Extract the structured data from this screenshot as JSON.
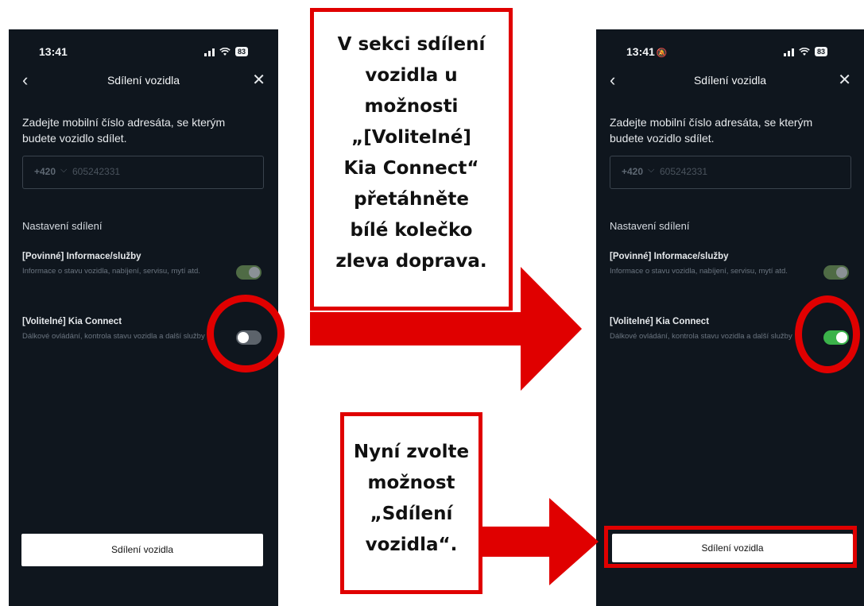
{
  "left_phone": {
    "status": {
      "time": "13:41",
      "battery": "83"
    },
    "nav": {
      "back": "‹",
      "title": "Sdílení vozidla",
      "close": "✕"
    },
    "instruction": "Zadejte mobilní číslo adresáta, se kterým budete vozidlo sdílet.",
    "phone_input": {
      "country_code": "+420",
      "chevron": "⌵",
      "number": "605242331"
    },
    "section_title": "Nastavení sdílení",
    "options": [
      {
        "title": "[Povinné] Informace/služby",
        "desc": "Informace o stavu vozidla, nabíjení, servisu, mytí atd.",
        "state": "on (disabled)"
      },
      {
        "title": "[Volitelné] Kia Connect",
        "desc": "Dálkové ovládání, kontrola stavu vozidla a další služby",
        "state": "off"
      }
    ],
    "share_button": "Sdílení vozidla"
  },
  "right_phone": {
    "status": {
      "time": "13:41",
      "mute_icon": "🔕",
      "battery": "83"
    },
    "nav": {
      "back": "‹",
      "title": "Sdílení vozidla",
      "close": "✕"
    },
    "instruction": "Zadejte mobilní číslo adresáta, se kterým budete vozidlo sdílet.",
    "phone_input": {
      "country_code": "+420",
      "chevron": "⌵",
      "number": "605242331"
    },
    "section_title": "Nastavení sdílení",
    "options": [
      {
        "title": "[Povinné] Informace/služby",
        "desc": "Informace o stavu vozidla, nabíjení, servisu, mytí atd.",
        "state": "on (disabled)"
      },
      {
        "title": "[Volitelné] Kia Connect",
        "desc": "Dálkové ovládání, kontrola stavu vozidla a další služby",
        "state": "on"
      }
    ],
    "share_button": "Sdílení vozidla"
  },
  "callouts": {
    "top": [
      "V sekci sdílení",
      "vozidla u",
      "možnosti",
      "„[Volitelné]",
      "Kia Connect“",
      "přetáhněte",
      "bílé kolečko",
      "zleva doprava."
    ],
    "bottom": [
      "Nyní zvolte",
      "možnost",
      "„Sdílení",
      "vozidla“."
    ]
  },
  "colors": {
    "phone_bg": "#0f161e",
    "accent_red": "#e00000",
    "toggle_on_green": "#3bb34a",
    "toggle_disabled_green": "#4f6b45",
    "toggle_off_gray": "#5c636b"
  },
  "icons": {
    "signal": "signal-icon",
    "wifi": "wifi-icon",
    "battery": "battery-icon",
    "back": "chevron-left-icon",
    "close": "close-icon",
    "arrow": "arrow-right-icon"
  }
}
